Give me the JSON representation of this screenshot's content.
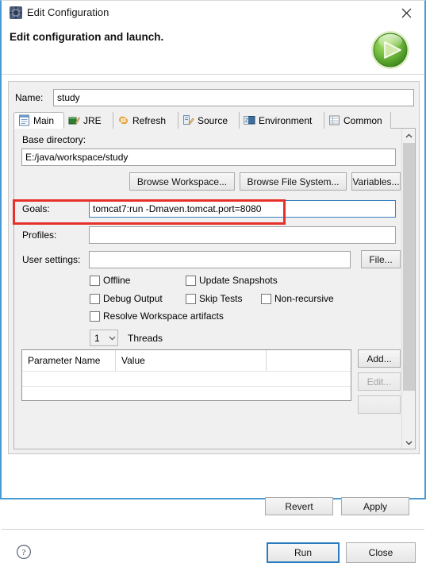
{
  "window": {
    "title": "Edit Configuration",
    "title_icon": "configuration-gear-icon",
    "close_icon": "close-icon",
    "accent_border_color": "#4a9ad4",
    "panel_bg_color": "#f0f0f0"
  },
  "header": {
    "title": "Edit configuration and launch.",
    "graphic_icon": "green-run-play-icon",
    "graphic_color": "#6cbb3c"
  },
  "form": {
    "name_label": "Name:",
    "name_value": "study"
  },
  "tabs": [
    {
      "label": "Main",
      "icon": "main-document-icon",
      "active": true
    },
    {
      "label": "JRE",
      "icon": "jre-book-icon",
      "active": false
    },
    {
      "label": "Refresh",
      "icon": "refresh-link-icon",
      "active": false
    },
    {
      "label": "Source",
      "icon": "source-pencil-icon",
      "active": false
    },
    {
      "label": "Environment",
      "icon": "environment-monitor-icon",
      "active": false
    },
    {
      "label": "Common",
      "icon": "common-table-icon",
      "active": false
    }
  ],
  "main_tab": {
    "base_directory_label": "Base directory:",
    "base_directory_value": "E:/java/workspace/study",
    "browse_workspace_label": "Browse Workspace...",
    "browse_file_system_label": "Browse File System...",
    "variables_label": "Variables...",
    "goals_label": "Goals:",
    "goals_value": "tomcat7:run -Dmaven.tomcat.port=8080",
    "profiles_label": "Profiles:",
    "profiles_value": "",
    "user_settings_label": "User settings:",
    "user_settings_value": "",
    "file_button_label": "File...",
    "checkboxes": [
      {
        "label": "Offline",
        "checked": false
      },
      {
        "label": "Update Snapshots",
        "checked": false
      },
      {
        "label": "Debug Output",
        "checked": false
      },
      {
        "label": "Skip Tests",
        "checked": false
      },
      {
        "label": "Non-recursive",
        "checked": false
      },
      {
        "label": "Resolve Workspace artifacts",
        "checked": false
      }
    ],
    "threads_value": "1",
    "threads_label": "Threads",
    "threads_chevron_icon": "chevron-down-icon",
    "parameter_table": {
      "columns": [
        "Parameter Name",
        "Value",
        ""
      ],
      "rows": []
    },
    "add_button_label": "Add...",
    "edit_button_label": "Edit...",
    "edit_button_disabled": true
  },
  "highlight": {
    "color": "#e8302a",
    "target": "goals-row"
  },
  "scrollbar": {
    "up_icon": "chevron-up-icon",
    "down_icon": "chevron-down-icon"
  },
  "footer": {
    "revert_label": "Revert",
    "apply_label": "Apply",
    "run_label": "Run",
    "close_label": "Close",
    "help_icon": "help-question-icon",
    "default_button": "Run",
    "focus_color": "#2a7ac0"
  }
}
